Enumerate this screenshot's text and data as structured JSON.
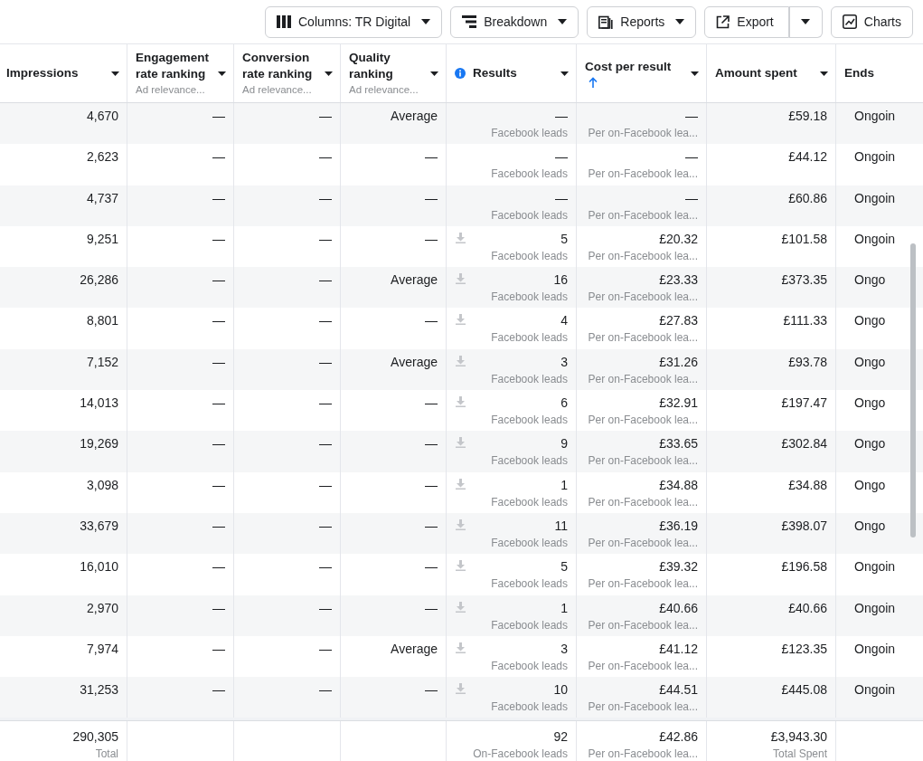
{
  "toolbar": [
    {
      "label": "Columns: TR Digital",
      "kind": "columns"
    },
    {
      "label": "Breakdown",
      "kind": "breakdown"
    },
    {
      "label": "Reports",
      "kind": "reports"
    },
    {
      "label": "Export",
      "kind": "export"
    },
    {
      "label": "Charts",
      "kind": "charts"
    }
  ],
  "columns": [
    {
      "label": "Impressions",
      "info_icon": false,
      "sorted_ascending": false,
      "caret": true
    },
    {
      "label": "Engagement rate ranking",
      "sub": "Ad relevance...",
      "info_icon": false,
      "sorted_ascending": false,
      "caret": true
    },
    {
      "label": "Conversion rate ranking",
      "sub": "Ad relevance...",
      "info_icon": false,
      "sorted_ascending": false,
      "caret": true
    },
    {
      "label": "Quality ranking",
      "sub": "Ad relevance...",
      "info_icon": false,
      "sorted_ascending": false,
      "caret": true
    },
    {
      "label": "Results",
      "info_icon": true,
      "sorted_ascending": false,
      "caret": true
    },
    {
      "label": "Cost per result",
      "info_icon": false,
      "sorted_ascending": true,
      "caret": true
    },
    {
      "label": "Amount spent",
      "info_icon": false,
      "sorted_ascending": false,
      "caret": true
    },
    {
      "label": "Ends",
      "info_icon": false,
      "sorted_ascending": false,
      "caret": false
    }
  ],
  "rows": [
    {
      "impressions": "4,670",
      "engagement": "—",
      "conversion": "—",
      "quality": "Average",
      "download_icon": false,
      "results": "—",
      "results_sub": "Facebook leads",
      "cost": "—",
      "cost_sub": "Per on-Facebook lea...",
      "amount": "£59.18",
      "ends": "Ongoin"
    },
    {
      "impressions": "2,623",
      "engagement": "—",
      "conversion": "—",
      "quality": "—",
      "download_icon": false,
      "results": "—",
      "results_sub": "Facebook leads",
      "cost": "—",
      "cost_sub": "Per on-Facebook lea...",
      "amount": "£44.12",
      "ends": "Ongoin"
    },
    {
      "impressions": "4,737",
      "engagement": "—",
      "conversion": "—",
      "quality": "—",
      "download_icon": false,
      "results": "—",
      "results_sub": "Facebook leads",
      "cost": "—",
      "cost_sub": "Per on-Facebook lea...",
      "amount": "£60.86",
      "ends": "Ongoin"
    },
    {
      "impressions": "9,251",
      "engagement": "—",
      "conversion": "—",
      "quality": "—",
      "download_icon": true,
      "results": "5",
      "results_sub": "Facebook leads",
      "cost": "£20.32",
      "cost_sub": "Per on-Facebook lea...",
      "amount": "£101.58",
      "ends": "Ongoin"
    },
    {
      "impressions": "26,286",
      "engagement": "—",
      "conversion": "—",
      "quality": "Average",
      "download_icon": true,
      "results": "16",
      "results_sub": "Facebook leads",
      "cost": "£23.33",
      "cost_sub": "Per on-Facebook lea...",
      "amount": "£373.35",
      "ends": "Ongo"
    },
    {
      "impressions": "8,801",
      "engagement": "—",
      "conversion": "—",
      "quality": "—",
      "download_icon": true,
      "results": "4",
      "results_sub": "Facebook leads",
      "cost": "£27.83",
      "cost_sub": "Per on-Facebook lea...",
      "amount": "£111.33",
      "ends": "Ongo"
    },
    {
      "impressions": "7,152",
      "engagement": "—",
      "conversion": "—",
      "quality": "Average",
      "download_icon": true,
      "results": "3",
      "results_sub": "Facebook leads",
      "cost": "£31.26",
      "cost_sub": "Per on-Facebook lea...",
      "amount": "£93.78",
      "ends": "Ongo"
    },
    {
      "impressions": "14,013",
      "engagement": "—",
      "conversion": "—",
      "quality": "—",
      "download_icon": true,
      "results": "6",
      "results_sub": "Facebook leads",
      "cost": "£32.91",
      "cost_sub": "Per on-Facebook lea...",
      "amount": "£197.47",
      "ends": "Ongo"
    },
    {
      "impressions": "19,269",
      "engagement": "—",
      "conversion": "—",
      "quality": "—",
      "download_icon": true,
      "results": "9",
      "results_sub": "Facebook leads",
      "cost": "£33.65",
      "cost_sub": "Per on-Facebook lea...",
      "amount": "£302.84",
      "ends": "Ongo"
    },
    {
      "impressions": "3,098",
      "engagement": "—",
      "conversion": "—",
      "quality": "—",
      "download_icon": true,
      "results": "1",
      "results_sub": "Facebook leads",
      "cost": "£34.88",
      "cost_sub": "Per on-Facebook lea...",
      "amount": "£34.88",
      "ends": "Ongo"
    },
    {
      "impressions": "33,679",
      "engagement": "—",
      "conversion": "—",
      "quality": "—",
      "download_icon": true,
      "results": "11",
      "results_sub": "Facebook leads",
      "cost": "£36.19",
      "cost_sub": "Per on-Facebook lea...",
      "amount": "£398.07",
      "ends": "Ongo"
    },
    {
      "impressions": "16,010",
      "engagement": "—",
      "conversion": "—",
      "quality": "—",
      "download_icon": true,
      "results": "5",
      "results_sub": "Facebook leads",
      "cost": "£39.32",
      "cost_sub": "Per on-Facebook lea...",
      "amount": "£196.58",
      "ends": "Ongoin"
    },
    {
      "impressions": "2,970",
      "engagement": "—",
      "conversion": "—",
      "quality": "—",
      "download_icon": true,
      "results": "1",
      "results_sub": "Facebook leads",
      "cost": "£40.66",
      "cost_sub": "Per on-Facebook lea...",
      "amount": "£40.66",
      "ends": "Ongoin"
    },
    {
      "impressions": "7,974",
      "engagement": "—",
      "conversion": "—",
      "quality": "Average",
      "download_icon": true,
      "results": "3",
      "results_sub": "Facebook leads",
      "cost": "£41.12",
      "cost_sub": "Per on-Facebook lea...",
      "amount": "£123.35",
      "ends": "Ongoin"
    },
    {
      "impressions": "31,253",
      "engagement": "—",
      "conversion": "—",
      "quality": "—",
      "download_icon": true,
      "results": "10",
      "results_sub": "Facebook leads",
      "cost": "£44.51",
      "cost_sub": "Per on-Facebook lea...",
      "amount": "£445.08",
      "ends": "Ongoin"
    }
  ],
  "totals": {
    "impressions": "290,305",
    "impressions_sub": "Total",
    "results": "92",
    "results_sub": "On-Facebook leads",
    "cost": "£42.86",
    "cost_sub": "Per on-Facebook lea...",
    "amount": "£3,943.30",
    "amount_sub": "Total Spent"
  }
}
